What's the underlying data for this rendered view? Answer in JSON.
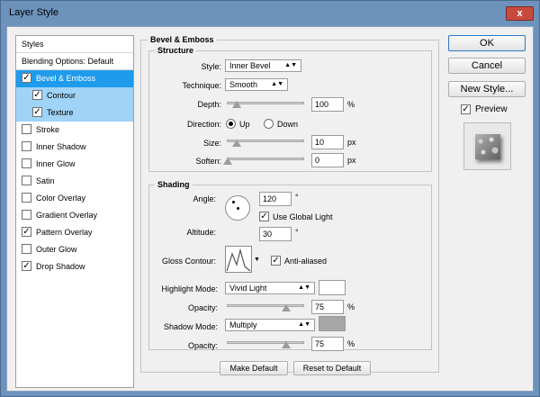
{
  "window": {
    "title": "Layer Style",
    "close": "x"
  },
  "list": {
    "header": "Styles",
    "items": [
      {
        "label": "Blending Options: Default",
        "checkbox": false
      },
      {
        "label": "Bevel & Emboss",
        "checkbox": true,
        "checked": true
      },
      {
        "label": "Contour",
        "checkbox": true,
        "checked": true
      },
      {
        "label": "Texture",
        "checkbox": true,
        "checked": true
      },
      {
        "label": "Stroke",
        "checkbox": true,
        "checked": false
      },
      {
        "label": "Inner Shadow",
        "checkbox": true,
        "checked": false
      },
      {
        "label": "Inner Glow",
        "checkbox": true,
        "checked": false
      },
      {
        "label": "Satin",
        "checkbox": true,
        "checked": false
      },
      {
        "label": "Color Overlay",
        "checkbox": true,
        "checked": false
      },
      {
        "label": "Gradient Overlay",
        "checkbox": true,
        "checked": false
      },
      {
        "label": "Pattern Overlay",
        "checkbox": true,
        "checked": true
      },
      {
        "label": "Outer Glow",
        "checkbox": true,
        "checked": false
      },
      {
        "label": "Drop Shadow",
        "checkbox": true,
        "checked": true
      }
    ]
  },
  "bevel": {
    "title": "Bevel & Emboss",
    "structure": {
      "title": "Structure",
      "style_label": "Style:",
      "style_value": "Inner Bevel",
      "technique_label": "Technique:",
      "technique_value": "Smooth",
      "depth_label": "Depth:",
      "depth_value": "100",
      "depth_unit": "%",
      "direction_label": "Direction:",
      "dir_up": "Up",
      "dir_down": "Down",
      "size_label": "Size:",
      "size_value": "10",
      "size_unit": "px",
      "soften_label": "Soften:",
      "soften_value": "0",
      "soften_unit": "px"
    },
    "shading": {
      "title": "Shading",
      "angle_label": "Angle:",
      "angle_value": "120",
      "angle_unit": "°",
      "global_light": "Use Global Light",
      "altitude_label": "Altitude:",
      "altitude_value": "30",
      "altitude_unit": "°",
      "gloss_label": "Gloss Contour:",
      "antialiased": "Anti-aliased",
      "highlight_label": "Highlight Mode:",
      "highlight_value": "Vivid Light",
      "hl_opacity_label": "Opacity:",
      "hl_opacity_value": "75",
      "hl_opacity_unit": "%",
      "shadow_label": "Shadow Mode:",
      "shadow_value": "Multiply",
      "sh_opacity_label": "Opacity:",
      "sh_opacity_value": "75",
      "sh_opacity_unit": "%"
    },
    "make_default": "Make Default",
    "reset_default": "Reset to Default"
  },
  "right": {
    "ok": "OK",
    "cancel": "Cancel",
    "new_style": "New Style...",
    "preview": "Preview"
  },
  "colors": {
    "highlight_swatch": "#ffffff",
    "shadow_swatch": "#a6a6a6",
    "selection": "#1f9bec"
  }
}
